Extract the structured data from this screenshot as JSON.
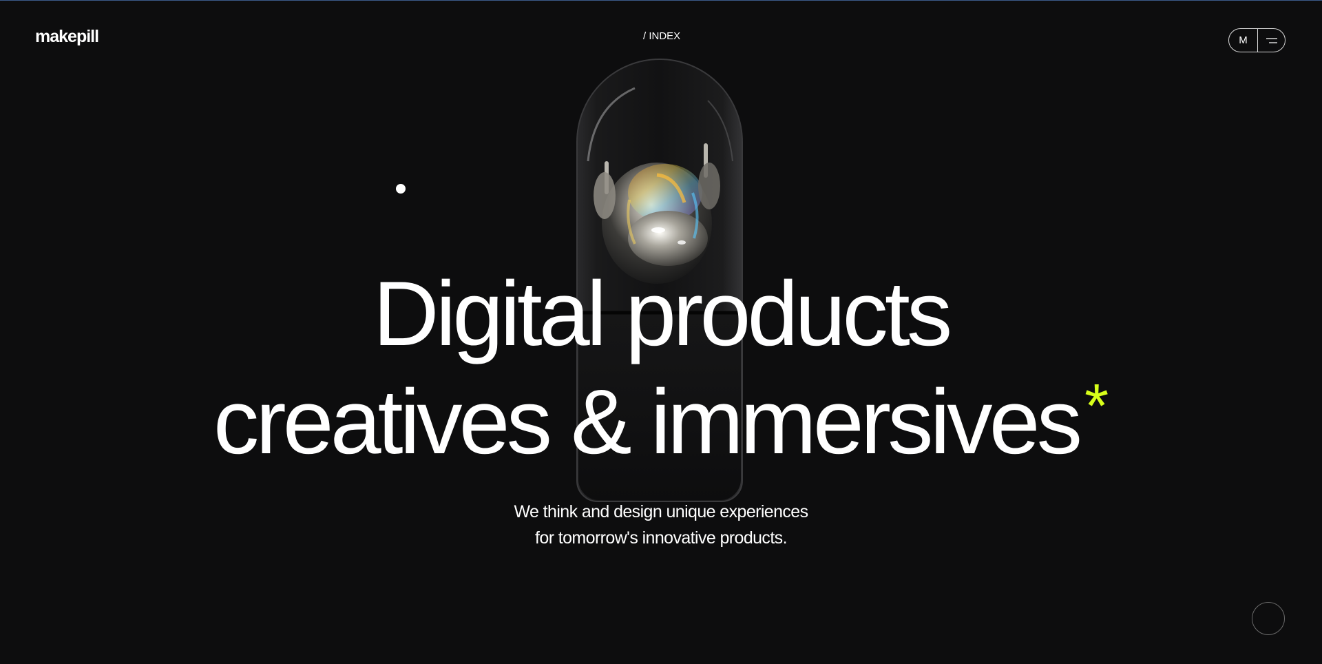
{
  "header": {
    "logo": "makepill",
    "page_label": "/ INDEX",
    "language": "M",
    "menu_icon": "hamburger-icon"
  },
  "hero": {
    "headline_line1": "Digital products",
    "headline_line2": "creatives & immersives",
    "asterisk": "*",
    "subline_line1": "We think and design unique experiences",
    "subline_line2": "for tomorrow's innovative products."
  },
  "colors": {
    "background": "#0d0d0e",
    "text": "#ffffff",
    "accent": "#d8ff1a"
  },
  "icons": {
    "visual": "robot-capsule-icon",
    "scroll": "scroll-circle-icon",
    "cursor": "cursor-dot-icon"
  }
}
